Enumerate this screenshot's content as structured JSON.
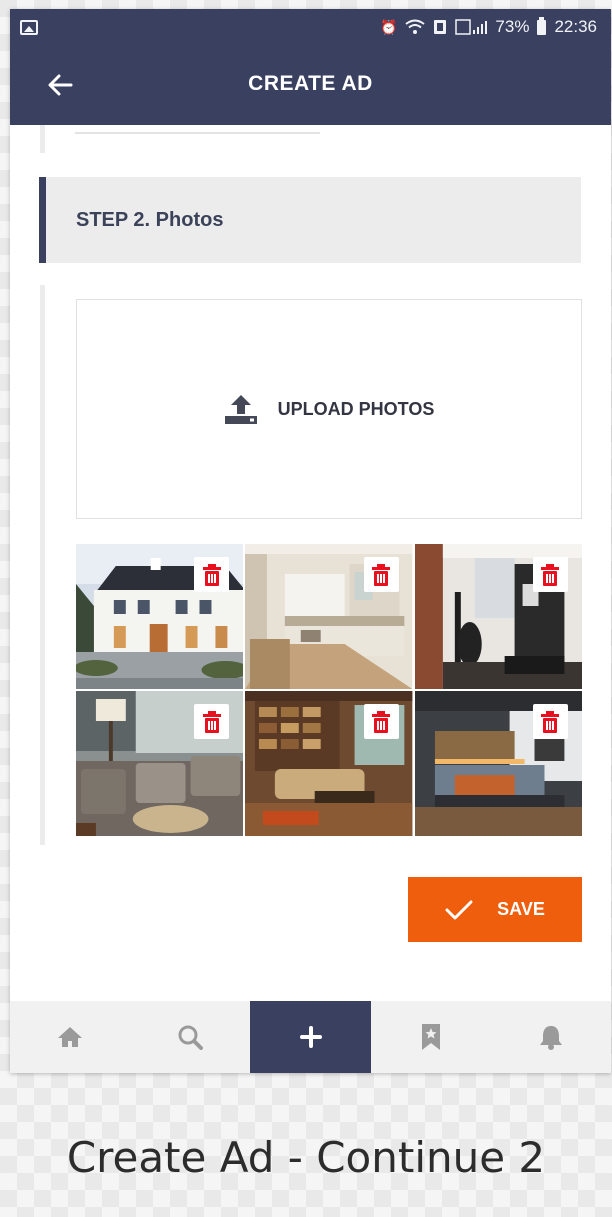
{
  "status_bar": {
    "battery_percent": "73%",
    "time": "22:36",
    "icons": [
      "gallery-icon",
      "alarm-icon",
      "wifi-icon",
      "data-icon",
      "signal-icon",
      "battery-icon"
    ]
  },
  "app_bar": {
    "title": "CREATE AD",
    "back_icon": "arrow-left-icon"
  },
  "step": {
    "title": "STEP 2. Photos"
  },
  "upload": {
    "label": "UPLOAD PHOTOS",
    "icon": "upload-icon"
  },
  "photos": [
    {
      "subject": "white-house-exterior",
      "delete_icon": "trash-icon"
    },
    {
      "subject": "modern-kitchen",
      "delete_icon": "trash-icon"
    },
    {
      "subject": "dark-living-room",
      "delete_icon": "trash-icon"
    },
    {
      "subject": "armchairs-lounge",
      "delete_icon": "trash-icon"
    },
    {
      "subject": "library-living-room",
      "delete_icon": "trash-icon"
    },
    {
      "subject": "bedroom",
      "delete_icon": "trash-icon"
    }
  ],
  "save": {
    "label": "SAVE",
    "icon": "check-icon"
  },
  "bottom_nav": {
    "items": [
      {
        "name": "home",
        "icon": "home-icon",
        "active": false
      },
      {
        "name": "search",
        "icon": "search-icon",
        "active": false
      },
      {
        "name": "add",
        "icon": "plus-icon",
        "active": true
      },
      {
        "name": "saved",
        "icon": "bookmark-icon",
        "active": false
      },
      {
        "name": "notifications",
        "icon": "bell-icon",
        "active": false
      }
    ]
  },
  "caption": "Create Ad - Continue 2",
  "colors": {
    "primary": "#3a4060",
    "accent": "#ef5e0c",
    "delete": "#e8101e",
    "step_background": "#ececec"
  }
}
